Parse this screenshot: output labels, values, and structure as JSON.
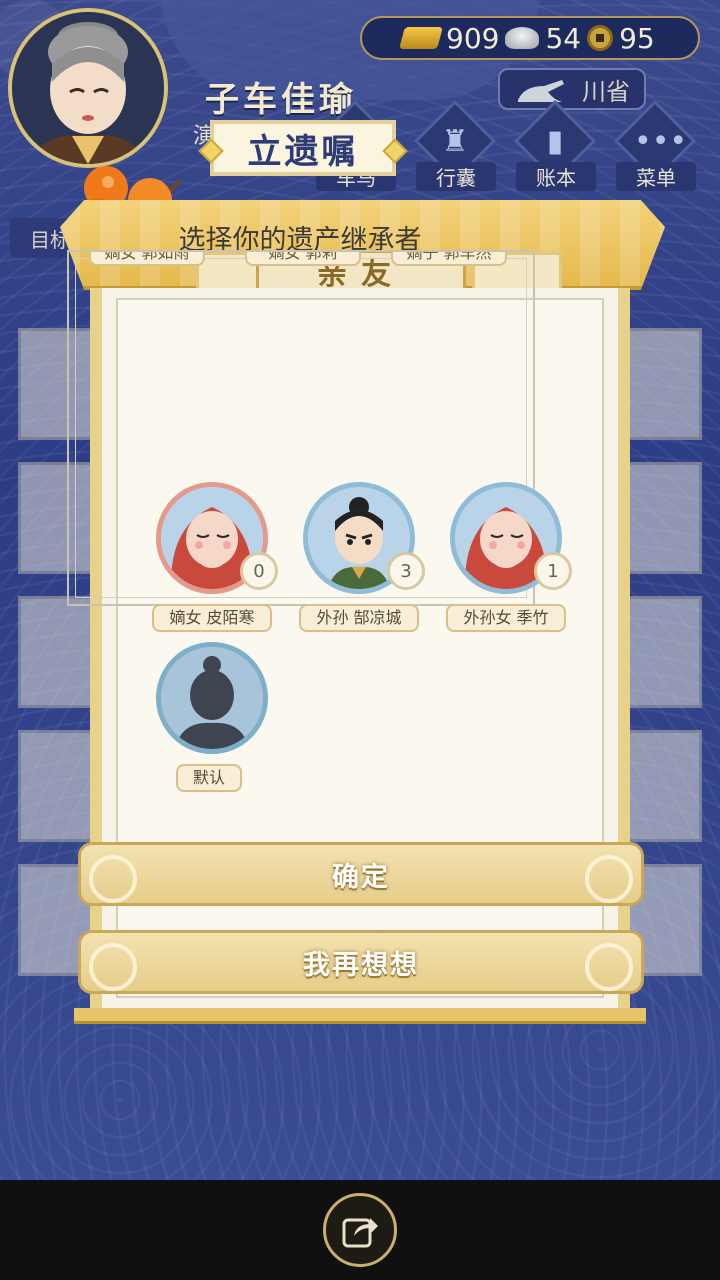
{
  "player": {
    "name": "子车佳瑜",
    "title": "演奏学徒"
  },
  "currency": {
    "gold": "909",
    "silver": "54",
    "coins": "95"
  },
  "province": {
    "label": "川省"
  },
  "menu": [
    {
      "label": "车马",
      "icon": "cart-icon"
    },
    {
      "label": "行囊",
      "icon": "bag-icon"
    },
    {
      "label": "账本",
      "icon": "ledger-icon"
    },
    {
      "label": "菜单",
      "icon": "more-icon"
    }
  ],
  "goal": {
    "label": "目标"
  },
  "dialog": {
    "header": "亲友",
    "title": "立遗嘱",
    "subtitle": "选择你的遗产继承者",
    "clipped_labels": [
      "嫡女 郭如雨",
      "嫡女 郭莉",
      "嫡子 郭车然"
    ],
    "heirs": [
      {
        "name": "嫡女 皮陌寒",
        "count": "0",
        "portrait": "female-baby"
      },
      {
        "name": "外孙 郜凉城",
        "count": "3",
        "portrait": "boy"
      },
      {
        "name": "外孙女 季竹",
        "count": "1",
        "portrait": "female-baby"
      },
      {
        "name": "默认",
        "count": "",
        "portrait": "silhouette"
      }
    ],
    "confirm_label": "确定",
    "cancel_label": "我再想想"
  },
  "colors": {
    "background": "#2d3f86",
    "gold_frame": "#e8d18a",
    "title_text": "#2d3c78"
  }
}
